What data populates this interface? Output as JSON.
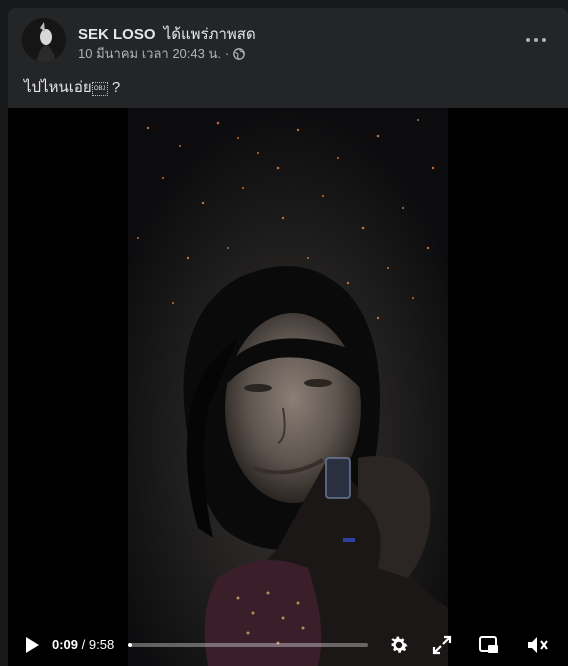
{
  "post": {
    "author": "SEK LOSO",
    "action": "ได้แพร่ภาพสด",
    "timestamp": "10 มีนาคม เวลา 20:43 น.",
    "separator": "·",
    "privacy_icon": "globe-icon",
    "more_icon": "more-options-icon",
    "caption_prefix": "ไปไหนเอ่ย",
    "caption_emoji": "OBJ",
    "caption_suffix": " ?"
  },
  "video": {
    "current_time": "0:09",
    "divider": " / ",
    "duration": "9:58",
    "progress_fraction": 0.016,
    "icons": {
      "play": "play-icon",
      "settings": "settings-gear-icon",
      "fullscreen": "fullscreen-icon",
      "pip": "picture-in-picture-icon",
      "mute": "muted-speaker-icon"
    }
  },
  "colors": {
    "background": "#18191a",
    "card": "#242526",
    "text_primary": "#e4e6eb",
    "text_secondary": "#b0b3b8"
  }
}
